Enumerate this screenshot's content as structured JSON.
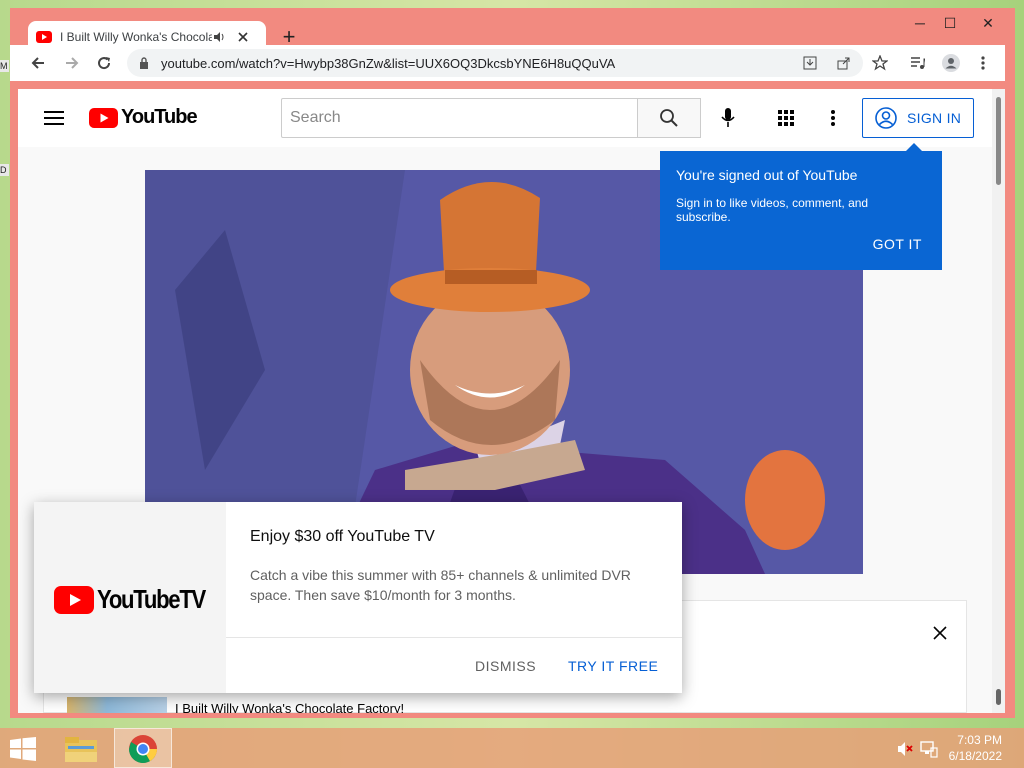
{
  "desktop": {
    "stub_top": "M",
    "stub_mid": "D"
  },
  "browser": {
    "tab": {
      "title": "I Built Willy Wonka's Chocolate Factory!"
    },
    "new_tab_label": "+",
    "url": "youtube.com/watch?v=Hwybp38GnZw&list=UUX6OQ3DkcsbYNE6H8uQQuVA",
    "window_buttons": {
      "minimize": "─",
      "maximize": "☐",
      "close": "✕"
    }
  },
  "youtube": {
    "logo_text": "YouTube",
    "search": {
      "placeholder": "Search"
    },
    "sign_in_label": "SIGN IN",
    "tooltip": {
      "title": "You're signed out of YouTube",
      "subtitle": "Sign in to like videos, comment, and subscribe.",
      "button": "GOT IT"
    },
    "video_title": "I Built Willy Wonka's Chocolate Factory!",
    "promo": {
      "logo_text": "YouTubeTV",
      "title": "Enjoy $30 off YouTube TV",
      "body": "Catch a vibe this summer with 85+ channels & unlimited DVR space. Then save $10/month for 3 months.",
      "dismiss": "DISMISS",
      "try": "TRY IT FREE"
    }
  },
  "taskbar": {
    "time": "7:03 PM",
    "date": "6/18/2022"
  },
  "colors": {
    "accent_blue": "#065fd4",
    "tooltip_bg": "#0a66d3",
    "yt_red": "#ff0000",
    "window_frame": "#f28a80"
  }
}
